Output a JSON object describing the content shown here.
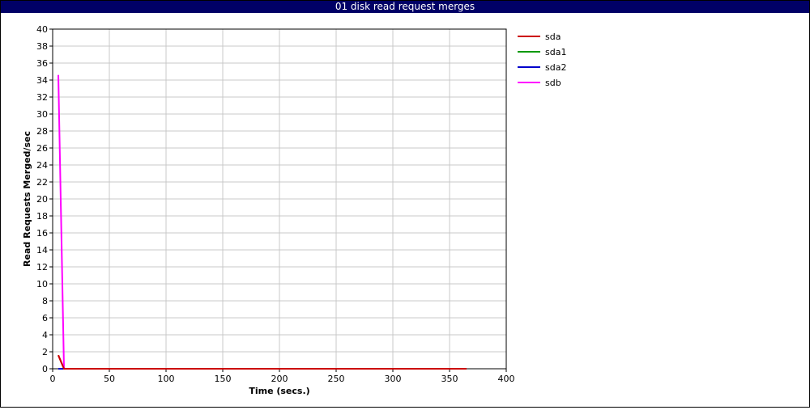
{
  "window": {
    "title": "01 disk read request merges"
  },
  "chart_data": {
    "type": "line",
    "title": "01 disk read request merges",
    "xlabel": "Time (secs.)",
    "ylabel": "Read Requests Merged/sec",
    "xlim": [
      0,
      400
    ],
    "ylim": [
      0,
      40
    ],
    "x_ticks": [
      0,
      50,
      100,
      150,
      200,
      250,
      300,
      350,
      400
    ],
    "y_ticks": [
      0,
      2,
      4,
      6,
      8,
      10,
      12,
      14,
      16,
      18,
      20,
      22,
      24,
      26,
      28,
      30,
      32,
      34,
      36,
      38,
      40
    ],
    "grid": true,
    "legend_position": "right",
    "series": [
      {
        "name": "sda",
        "color": "#cc0000",
        "x": [
          5,
          10,
          15,
          365
        ],
        "y": [
          1.6,
          0,
          0,
          0
        ]
      },
      {
        "name": "sda1",
        "color": "#009900",
        "x": [
          5,
          10,
          15,
          365
        ],
        "y": [
          0,
          0,
          0,
          0
        ]
      },
      {
        "name": "sda2",
        "color": "#0000cc",
        "x": [
          5,
          10,
          15,
          365
        ],
        "y": [
          0,
          0,
          0,
          0
        ]
      },
      {
        "name": "sdb",
        "color": "#ff00ff",
        "x": [
          5,
          10,
          15,
          365
        ],
        "y": [
          34.6,
          0,
          0,
          0
        ]
      }
    ]
  }
}
